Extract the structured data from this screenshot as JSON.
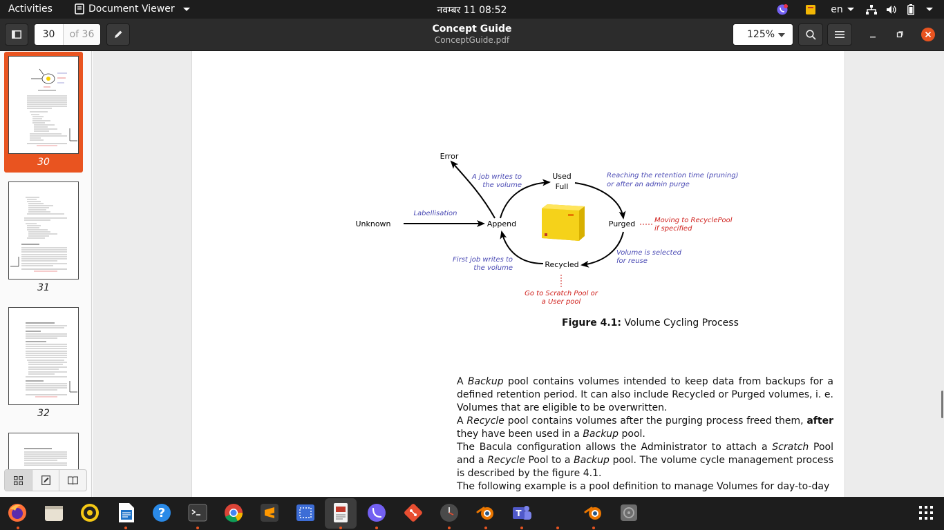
{
  "topbar": {
    "activities": "Activities",
    "app_menu": "Document Viewer",
    "clock": "नवम्बर 11  08:52",
    "keyboard_layout": "en"
  },
  "headerbar": {
    "page_current": "30",
    "page_total": "of 36",
    "title": "Concept Guide",
    "subtitle": "ConceptGuide.pdf",
    "zoom": "125%"
  },
  "sidebar": {
    "thumbnails": [
      {
        "label": "30",
        "selected": true
      },
      {
        "label": "31",
        "selected": false
      },
      {
        "label": "32",
        "selected": false
      }
    ]
  },
  "diagram": {
    "nodes": {
      "error": "Error",
      "unknown": "Unknown",
      "append": "Append",
      "used": "Used",
      "full": "Full",
      "purged": "Purged",
      "recycled": "Recycled"
    },
    "annotations": {
      "labellisation": "Labellisation",
      "job_writes_1": "A job writes to",
      "job_writes_2": "the volume",
      "retention_1": "Reaching the retention time (pruning)",
      "retention_2": "or after an admin purge",
      "recyclepool_1": "Moving to RecyclePool",
      "recyclepool_2": "if specified",
      "selected_1": "Volume is selected",
      "selected_2": "for reuse",
      "first_job_1": "First job writes to",
      "first_job_2": "the volume",
      "scratch_1": "Go to Scratch Pool or",
      "scratch_2": "a User pool"
    },
    "colors": {
      "blue": "#4a4ab4",
      "red": "#d0201c"
    }
  },
  "caption": {
    "label": "Figure 4.1:",
    "text": "Volume Cycling Process"
  },
  "body": {
    "p1_a": "A ",
    "p1_em": "Backup",
    "p1_b": " pool contains volumes intended to keep data from backups for a defined retention period. It can also include Recycled or Purged volumes, i. e. Volumes that are eligible to be overwritten.",
    "p2_a": "A ",
    "p2_em": "Recycle",
    "p2_b": " pool contains volumes after the purging process freed them, ",
    "p2_strong": "after",
    "p2_c": " they have been used in a ",
    "p2_em2": "Backup",
    "p2_d": " pool.",
    "p3_a": "The Bacula configuration allows the Administrator to attach a ",
    "p3_em": "Scratch",
    "p3_b": " Pool and a ",
    "p3_em2": "Recycle",
    "p3_c": " Pool to a ",
    "p3_em3": "Backup",
    "p3_d": " pool. The volume cycle management process is described by the figure 4.1.",
    "p4": "The following example is a pool definition to manage Volumes for day-to-day"
  },
  "dock": {
    "apps": [
      "firefox-icon",
      "files-icon",
      "rhythmbox-icon",
      "writer-icon",
      "help-icon",
      "terminal-icon",
      "chrome-icon",
      "sublime-icon",
      "screenshot-icon",
      "document-viewer-icon",
      "viber-icon",
      "git-icon",
      "clock-icon",
      "blender-icon",
      "teams-icon",
      "blender2-icon",
      "disk-icon",
      "app-grid-icon"
    ]
  }
}
